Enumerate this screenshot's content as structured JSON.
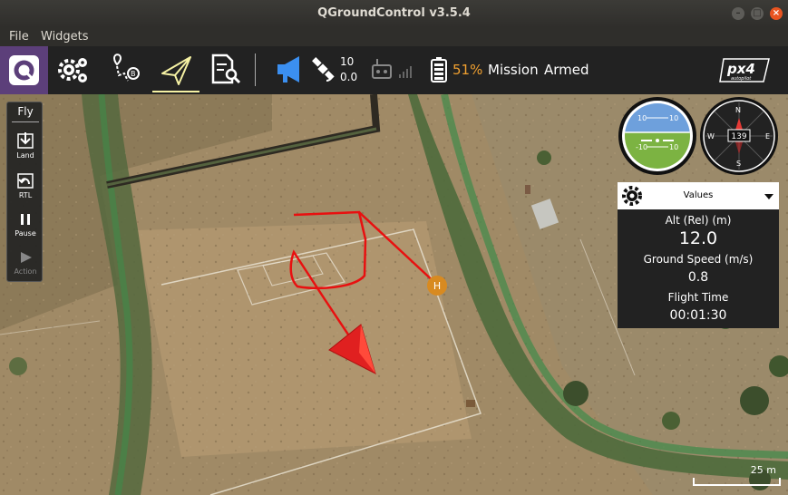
{
  "window": {
    "title": "QGroundControl v3.5.4"
  },
  "menubar": {
    "file": "File",
    "widgets": "Widgets"
  },
  "toolbar": {
    "settings_icon": "gear-icon",
    "plan_icon": "plan-path-icon",
    "fly_icon": "paper-plane-icon",
    "analyze_icon": "document-search-icon",
    "message_icon": "megaphone-icon",
    "gps_sats": "10",
    "gps_hdop": "0.0",
    "battery_percent": "51%",
    "flight_mode": "Mission",
    "armed_state": "Armed",
    "brand_logo": "px4 autopilot",
    "battery_color": "#f0a030",
    "message_color": "#3b8ff0"
  },
  "fly_panel": {
    "title": "Fly",
    "land": "Land",
    "rtl": "RTL",
    "pause": "Pause",
    "action": "Action"
  },
  "attitude": {
    "top_left": "10",
    "top_right": "10",
    "bottom_left": "-10",
    "bottom_right": "10"
  },
  "compass": {
    "heading": "139",
    "n": "N",
    "e": "E",
    "s": "S",
    "w": "W"
  },
  "values_panel": {
    "header": "Values",
    "rows": [
      {
        "label": "Alt (Rel) (m)",
        "value": "12.0"
      },
      {
        "label": "Ground Speed (m/s)",
        "value": "0.8"
      },
      {
        "label": "Flight Time",
        "value": "00:01:30"
      }
    ]
  },
  "map": {
    "home_label": "H",
    "scale_label": "25 m",
    "track_color": "#e81010",
    "home_color": "#d88a20"
  }
}
